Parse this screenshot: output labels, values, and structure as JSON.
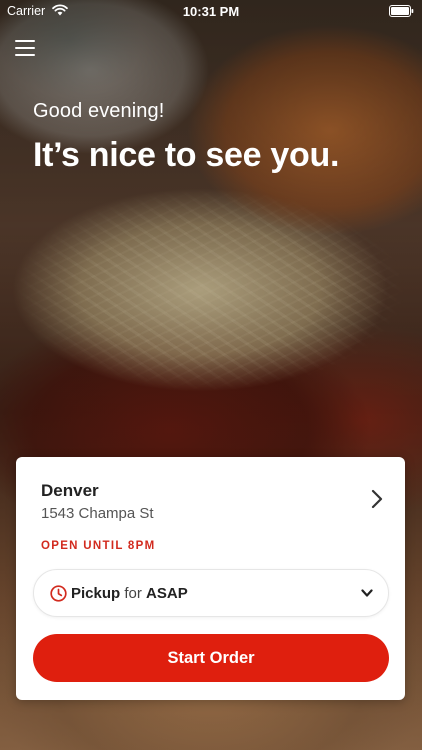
{
  "status_bar": {
    "carrier": "Carrier",
    "time": "10:31 PM"
  },
  "header": {
    "greeting": "Good evening!",
    "headline": "It’s nice to see you."
  },
  "location": {
    "city": "Denver",
    "address": "1543 Champa St",
    "hours": "OPEN UNTIL 8PM"
  },
  "order_mode": {
    "mode": "Pickup",
    "connector": "for",
    "time": "ASAP"
  },
  "actions": {
    "start_order": "Start Order"
  },
  "colors": {
    "accent": "#df1f0e",
    "hours_text": "#d22a1e"
  },
  "icons": [
    "wifi-icon",
    "battery-icon",
    "menu-icon",
    "chevron-right-icon",
    "clock-icon",
    "chevron-down-icon"
  ]
}
